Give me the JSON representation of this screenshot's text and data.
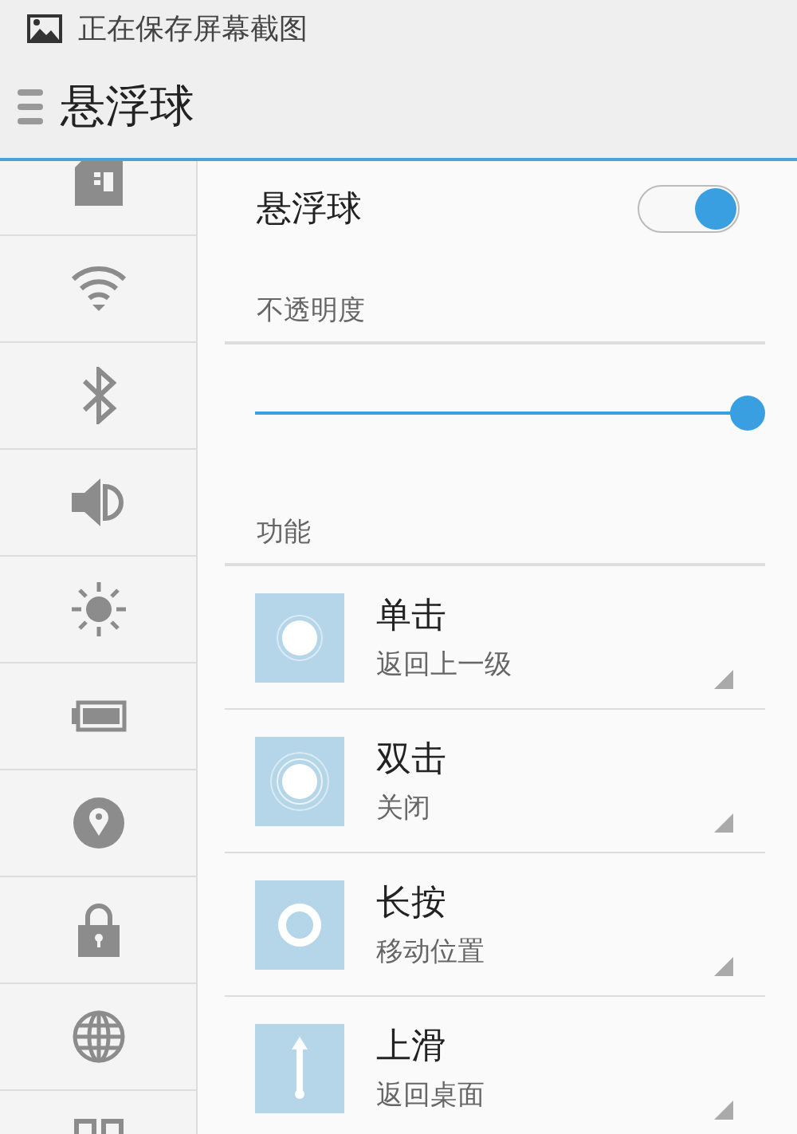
{
  "status_bar": {
    "notification": "正在保存屏幕截图"
  },
  "title_bar": {
    "title": "悬浮球"
  },
  "toggle": {
    "label": "悬浮球",
    "on": true
  },
  "opacity": {
    "header": "不透明度",
    "level": 1
  },
  "functions": {
    "header": "功能",
    "items": [
      {
        "kind": "tap",
        "title": "单击",
        "value": "返回上一级"
      },
      {
        "kind": "double-tap",
        "title": "双击",
        "value": "关闭"
      },
      {
        "kind": "long-press",
        "title": "长按",
        "value": "移动位置"
      },
      {
        "kind": "swipe-up",
        "title": "上滑",
        "value": "返回桌面"
      }
    ]
  }
}
